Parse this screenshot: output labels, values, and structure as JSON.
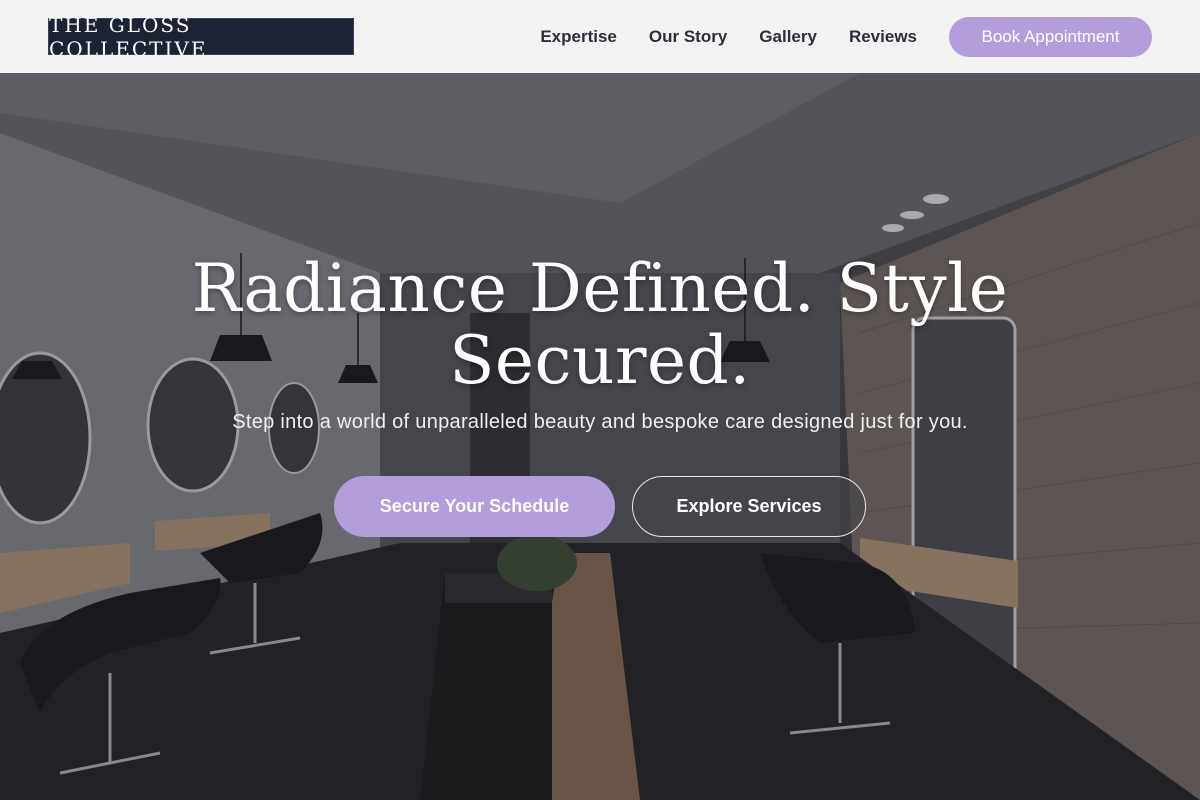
{
  "brand": {
    "name": "THE GLOSS COLLECTIVE"
  },
  "nav": {
    "items": [
      {
        "label": "Expertise"
      },
      {
        "label": "Our Story"
      },
      {
        "label": "Gallery"
      },
      {
        "label": "Reviews"
      }
    ],
    "cta_label": "Book Appointment"
  },
  "hero": {
    "title": "Radiance Defined. Style Secured.",
    "subtitle": "Step into a world of unparalleled beauty and bespoke care designed just for you.",
    "primary_cta": "Secure Your Schedule",
    "secondary_cta": "Explore Services"
  },
  "colors": {
    "accent": "#b39ddb",
    "logo_bg": "#1c2333",
    "header_bg": "#f3f3f3",
    "nav_text": "#2b2f3a"
  }
}
